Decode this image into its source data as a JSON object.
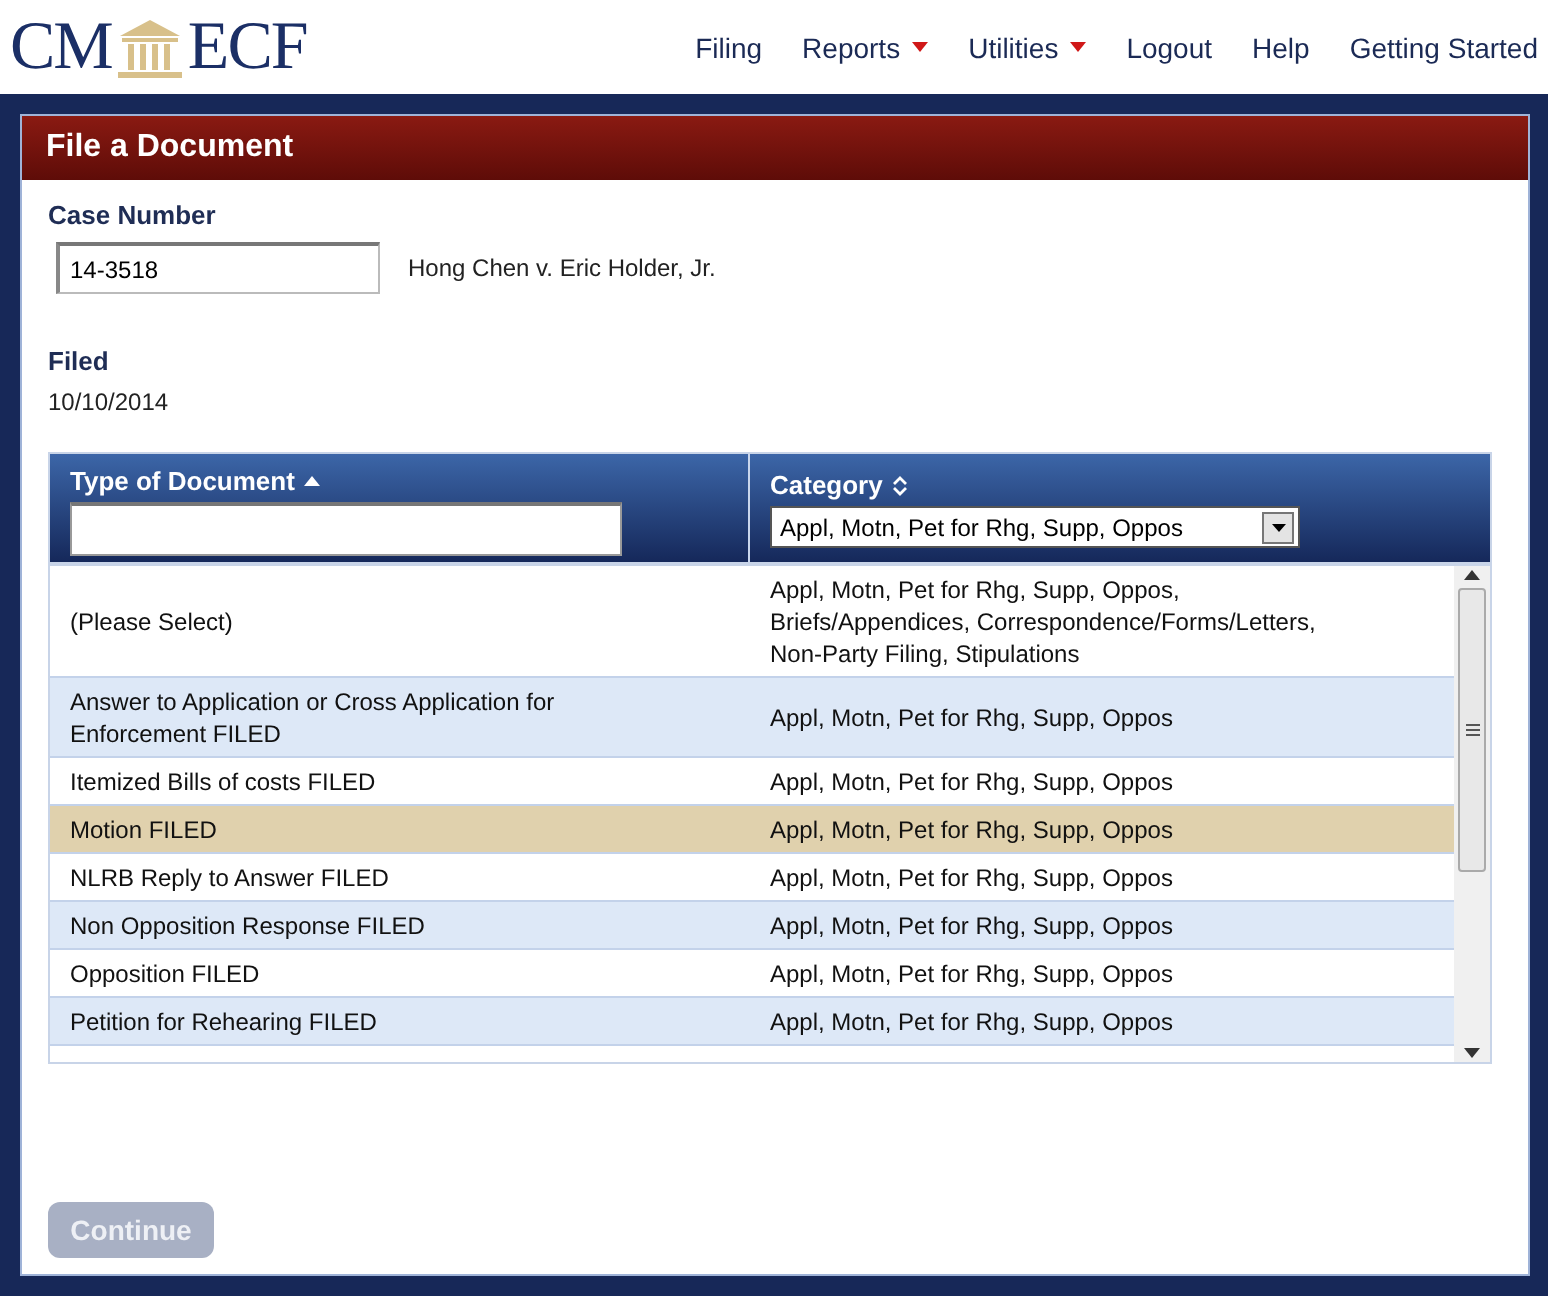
{
  "logo": {
    "left": "CM",
    "right": "ECF"
  },
  "nav": [
    {
      "label": "Filing",
      "dropdown": false
    },
    {
      "label": "Reports",
      "dropdown": true
    },
    {
      "label": "Utilities",
      "dropdown": true
    },
    {
      "label": "Logout",
      "dropdown": false
    },
    {
      "label": "Help",
      "dropdown": false
    },
    {
      "label": "Getting Started",
      "dropdown": false
    }
  ],
  "panel": {
    "title": "File a Document"
  },
  "case": {
    "label": "Case Number",
    "value": "14-3518",
    "caption": "Hong Chen v. Eric Holder, Jr."
  },
  "filed": {
    "label": "Filed",
    "value": "10/10/2014"
  },
  "table": {
    "columns": [
      {
        "label": "Type of Document",
        "sorted": true,
        "kind": "text"
      },
      {
        "label": "Category",
        "sorted": false,
        "kind": "select",
        "value": "Appl, Motn, Pet for Rhg, Supp, Oppos"
      }
    ],
    "rows": [
      {
        "type": "(Please Select)",
        "category": "Appl, Motn, Pet for Rhg, Supp, Oppos, Briefs/Appendices, Correspondence/Forms/Letters, Non-Party Filing, Stipulations",
        "selected": false
      },
      {
        "type": "Answer to Application or Cross Application for Enforcement FILED",
        "category": "Appl, Motn, Pet for Rhg, Supp, Oppos",
        "selected": false
      },
      {
        "type": "Itemized Bills of costs FILED",
        "category": "Appl, Motn, Pet for Rhg, Supp, Oppos",
        "selected": false
      },
      {
        "type": "Motion FILED",
        "category": "Appl, Motn, Pet for Rhg, Supp, Oppos",
        "selected": true
      },
      {
        "type": "NLRB Reply to Answer FILED",
        "category": "Appl, Motn, Pet for Rhg, Supp, Oppos",
        "selected": false
      },
      {
        "type": "Non Opposition Response FILED",
        "category": "Appl, Motn, Pet for Rhg, Supp, Oppos",
        "selected": false
      },
      {
        "type": "Opposition FILED",
        "category": "Appl, Motn, Pet for Rhg, Supp, Oppos",
        "selected": false
      },
      {
        "type": "Petition for Rehearing FILED",
        "category": "Appl, Motn, Pet for Rhg, Supp, Oppos",
        "selected": false
      }
    ]
  },
  "continue_button": {
    "label": "Continue",
    "disabled": true
  }
}
